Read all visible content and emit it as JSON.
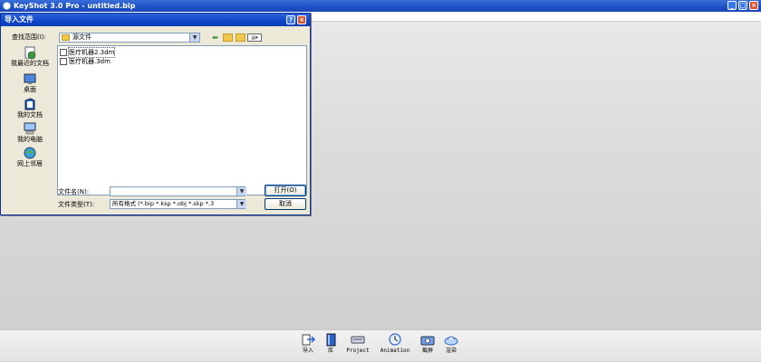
{
  "window": {
    "title": "KeyShot 3.0 Pro - untitled.bip",
    "minimize": "_",
    "maximize": "□",
    "close": "×"
  },
  "dialog": {
    "title": "导入文件",
    "help": "?",
    "close": "×",
    "look_in_label": "查找范围(I):",
    "look_in_value": "源文件",
    "places": [
      {
        "label": "我最近的文档",
        "icon": "recent-documents-icon"
      },
      {
        "label": "桌面",
        "icon": "desktop-icon"
      },
      {
        "label": "我的文档",
        "icon": "my-documents-icon"
      },
      {
        "label": "我的电脑",
        "icon": "my-computer-icon"
      },
      {
        "label": "网上邻居",
        "icon": "network-places-icon"
      }
    ],
    "files": [
      {
        "name": "医疗机器2.3dm",
        "selected": true
      },
      {
        "name": "医疗机器.3dm",
        "selected": false
      }
    ],
    "filename_label": "文件名(N):",
    "filename_value": "",
    "filetype_label": "文件类型(T):",
    "filetype_value": "所有格式 (*.bip *.ksp *.obj *.skp *.3",
    "open_button": "打开(O)",
    "cancel_button": "取消"
  },
  "toolbar": {
    "items": [
      {
        "label": "导入",
        "icon": "import-icon"
      },
      {
        "label": "库",
        "icon": "library-icon"
      },
      {
        "label": "Project",
        "icon": "project-icon"
      },
      {
        "label": "Animation",
        "icon": "animation-icon"
      },
      {
        "label": "截屏",
        "icon": "screenshot-icon"
      },
      {
        "label": "渲染",
        "icon": "render-icon"
      }
    ]
  },
  "colors": {
    "titlebar": "#1d4fc4",
    "dialog_face": "#ece9d8",
    "viewport": "#dcdcdc"
  }
}
